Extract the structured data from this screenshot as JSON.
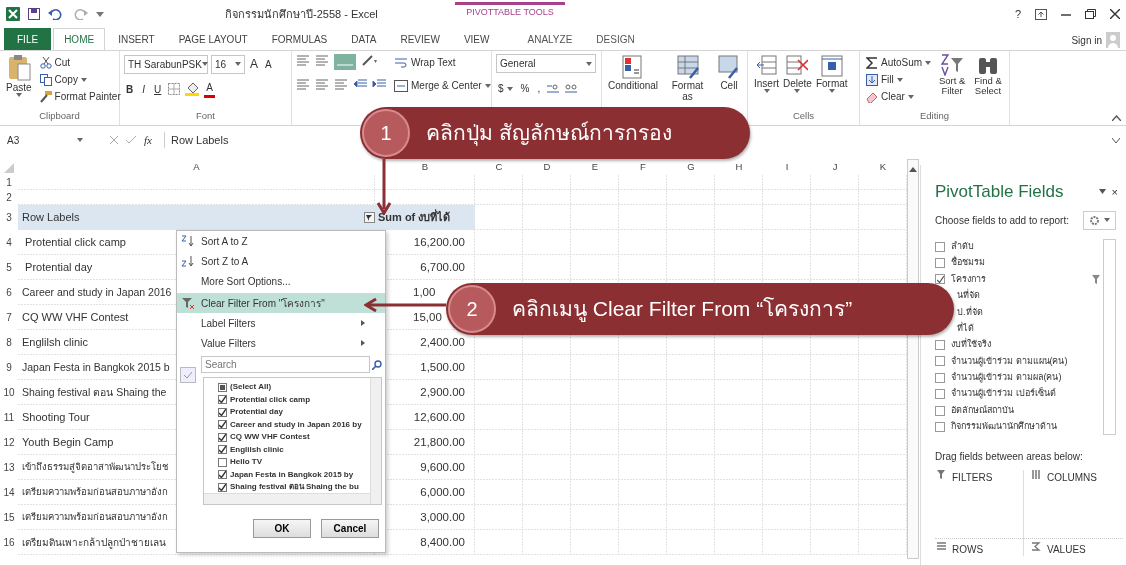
{
  "window": {
    "title": "กิจกรรมนักศึกษาปี-2558 - Excel",
    "help": "?",
    "sign_in": "Sign in"
  },
  "contextual_group": "PIVOTTABLE TOOLS",
  "ribbon_tabs": [
    {
      "label": "FILE",
      "kind": "file",
      "selected": false
    },
    {
      "label": "HOME",
      "kind": "tab",
      "selected": true
    },
    {
      "label": "INSERT",
      "kind": "tab",
      "selected": false
    },
    {
      "label": "PAGE LAYOUT",
      "kind": "tab",
      "selected": false
    },
    {
      "label": "FORMULAS",
      "kind": "tab",
      "selected": false
    },
    {
      "label": "DATA",
      "kind": "tab",
      "selected": false
    },
    {
      "label": "REVIEW",
      "kind": "tab",
      "selected": false
    },
    {
      "label": "VIEW",
      "kind": "tab",
      "selected": false
    },
    {
      "label": "ANALYZE",
      "kind": "contextual",
      "selected": false
    },
    {
      "label": "DESIGN",
      "kind": "contextual",
      "selected": false
    }
  ],
  "ribbon": {
    "clipboard": {
      "paste": "Paste",
      "cut": "Cut",
      "copy": "Copy",
      "format_painter": "Format Painter",
      "label": "Clipboard"
    },
    "font": {
      "name": "TH SarabunPSK",
      "size": "16",
      "grow": "A",
      "shrink": "A",
      "bold": "B",
      "italic": "I",
      "underline": "U",
      "font_color": "A",
      "label": "Font"
    },
    "alignment": {
      "wrap_text": "Wrap Text",
      "merge_center": "Merge & Center"
    },
    "number": {
      "format": "General",
      "currency": "$",
      "percent": "%",
      "comma": ","
    },
    "styles": [
      "Conditional",
      "Format as",
      "Cell"
    ],
    "cells": {
      "buttons": [
        "Insert",
        "Delete",
        "Format"
      ],
      "label": "Cells"
    },
    "editing": {
      "autosum": "AutoSum",
      "fill": "Fill",
      "clear": "Clear",
      "sort_filter": "Sort & Filter",
      "find_select": "Find & Select",
      "label": "Editing"
    }
  },
  "formula_bar": {
    "name_box": "A3",
    "function_symbol": "fx",
    "formula": "Row Labels"
  },
  "sheet": {
    "columns": [
      "A",
      "B",
      "C",
      "D",
      "E",
      "F",
      "G",
      "H",
      "I",
      "J",
      "K"
    ],
    "rows": [
      {
        "number": "1",
        "kind": "blank"
      },
      {
        "number": "2",
        "kind": "blank"
      },
      {
        "number": "3",
        "kind": "header",
        "label": "Row Labels",
        "value": "Sum of งบที่ได้"
      },
      {
        "number": "4",
        "kind": "data",
        "label": " Protential click camp",
        "value": "16,200.00",
        "cut": false
      },
      {
        "number": "5",
        "kind": "data",
        "label": " Protential day",
        "value": "6,700.00",
        "cut": false
      },
      {
        "number": "6",
        "kind": "data",
        "label": "Career and study in Japan 2016",
        "value": "1,00",
        "cut": true
      },
      {
        "number": "7",
        "kind": "data",
        "label": "CQ WW VHF Contest",
        "value": "15,00",
        "cut": true
      },
      {
        "number": "8",
        "kind": "data",
        "label": "Englilsh clinic",
        "value": "2,400.00",
        "cut": false
      },
      {
        "number": "9",
        "kind": "data",
        "label": "Japan Festa in Bangkok 2015 b",
        "value": "1,500.00",
        "cut": false
      },
      {
        "number": "10",
        "kind": "data",
        "label": "Shaing festival ตอน Shaing the",
        "value": "2,900.00",
        "cut": false
      },
      {
        "number": "11",
        "kind": "data",
        "label": "Shooting Tour",
        "value": "12,600.00",
        "cut": false
      },
      {
        "number": "12",
        "kind": "data",
        "label": "Youth Begin Camp",
        "value": "21,800.00",
        "cut": false
      },
      {
        "number": "13",
        "kind": "data",
        "label": "เข้าถึงธรรมสู่จิตอาสาพัฒนาประโยช",
        "value": "9,600.00",
        "cut": false
      },
      {
        "number": "14",
        "kind": "data",
        "label": "เตรียมความพร้อมก่อนสอบภาษาอังก",
        "value": "6,000.00",
        "cut": false
      },
      {
        "number": "15",
        "kind": "data",
        "label": "เตรียมความพร้อมก่อนสอบภาษาอังก",
        "value": "3,000.00",
        "cut": false
      },
      {
        "number": "16",
        "kind": "data",
        "label": "เตรียมดินเพาะกล้าปลูกป่าชายเลน",
        "value": "8,400.00",
        "cut": false
      }
    ]
  },
  "filter_menu": {
    "items": [
      {
        "label": "Sort A to Z",
        "kind": "sort_az",
        "selected": false,
        "has_submenu": false
      },
      {
        "label": "Sort Z to A",
        "kind": "sort_za",
        "selected": false,
        "has_submenu": false
      },
      {
        "label": "More Sort Options...",
        "kind": "plain",
        "selected": false,
        "has_submenu": false
      },
      {
        "label": "Clear Filter From \"โครงการ\"",
        "kind": "clear_filter",
        "selected": true,
        "has_submenu": false
      },
      {
        "label": "Label Filters",
        "kind": "plain",
        "selected": false,
        "has_submenu": true
      },
      {
        "label": "Value Filters",
        "kind": "plain",
        "selected": false,
        "has_submenu": true
      }
    ],
    "search_placeholder": "Search",
    "checklist": [
      {
        "label": "(Select All)",
        "checked": false,
        "mixed": true
      },
      {
        "label": "Protential click camp",
        "checked": true,
        "mixed": false
      },
      {
        "label": "Protential day",
        "checked": true,
        "mixed": false
      },
      {
        "label": "Career and study in Japan 2016 by",
        "checked": true,
        "mixed": false
      },
      {
        "label": "CQ WW VHF Contest",
        "checked": true,
        "mixed": false
      },
      {
        "label": "Englilsh clinic",
        "checked": true,
        "mixed": false
      },
      {
        "label": "Hello  TV",
        "checked": false,
        "mixed": false
      },
      {
        "label": "Japan Festa in Bangkok 2015 by",
        "checked": true,
        "mixed": false
      },
      {
        "label": "Shaing festival ตอน Shaing the bu",
        "checked": true,
        "mixed": false
      }
    ],
    "buttons": [
      "OK",
      "Cancel"
    ]
  },
  "pivot_fields": {
    "title": "PivotTable Fields",
    "close": "×",
    "prompt": "Choose fields to add to report:",
    "fields": [
      {
        "label": "ลำดับ",
        "checked": false,
        "filtered": false,
        "covered": false
      },
      {
        "label": "ชื่อชมรม",
        "checked": false,
        "filtered": false,
        "covered": false
      },
      {
        "label": "โครงการ",
        "checked": true,
        "filtered": true,
        "covered": false
      },
      {
        "label": "นที่จัด",
        "filtered": false,
        "covered": true
      },
      {
        "label": "ป.ที่จัด",
        "filtered": false,
        "covered": true
      },
      {
        "label": "ที่ได้",
        "filtered": false,
        "covered": true
      },
      {
        "label": "งบที่ใช้จริง",
        "checked": false,
        "filtered": false,
        "covered": false
      },
      {
        "label": "จำนวนผู้เข้าร่วม ตามแผน(คน)",
        "checked": false,
        "filtered": false,
        "covered": false
      },
      {
        "label": "จำนวนผู้เข้าร่วม ตามผล(คน)",
        "checked": false,
        "filtered": false,
        "covered": false
      },
      {
        "label": "จำนวนผู้เข้าร่วม เปอร์เซ็นต์",
        "checked": false,
        "filtered": false,
        "covered": false
      },
      {
        "label": "อัตลักษณ์สถาบัน",
        "checked": false,
        "filtered": false,
        "covered": false
      },
      {
        "label": "กิจกรรมพัฒนานักศึกษาด้าน",
        "checked": false,
        "filtered": false,
        "covered": false
      }
    ],
    "drag_prompt": "Drag fields between areas below:",
    "areas": [
      "FILTERS",
      "COLUMNS",
      "ROWS",
      "VALUES"
    ]
  },
  "callouts": [
    {
      "number": "1",
      "text": "คลิกปุ่ม สัญลักษณ์การกรอง"
    },
    {
      "number": "2",
      "text": "คลิกเมนู Clear Filter From “โครงการ”"
    }
  ]
}
